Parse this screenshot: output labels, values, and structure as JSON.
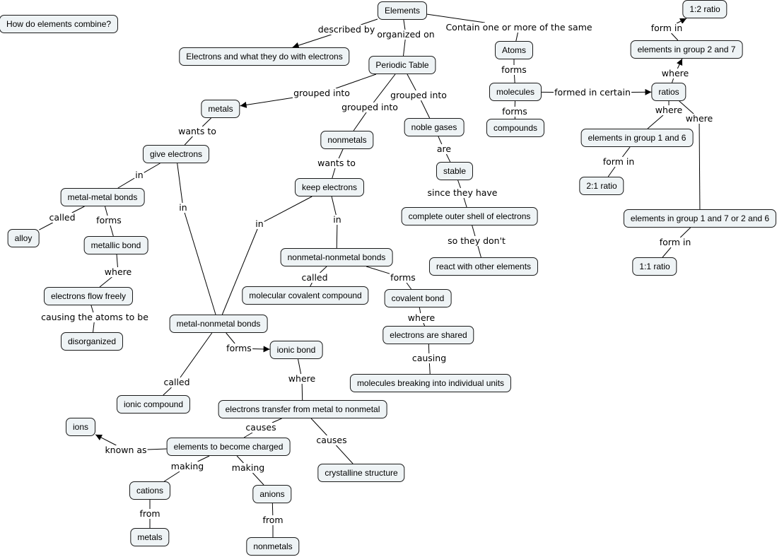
{
  "diagram_type": "concept map",
  "colors": {
    "node_fill": "#eef3f5",
    "node_border": "#1a1a1a",
    "line": "#000000"
  },
  "nodes": {
    "question": "How do elements combine?",
    "elements": "Elements",
    "electrons_desc": "Electrons and what they do with electrons",
    "periodic_table": "Periodic Table",
    "atoms": "Atoms",
    "molecules": "molecules",
    "compounds": "compounds",
    "ratios": "ratios",
    "ratio_12": "1:2 ratio",
    "group_2_7": "elements in group 2 and 7",
    "group_1_6": "elements in group 1 and 6",
    "ratio_21": "2:1 ratio",
    "group_17_26": "elements in group 1 and 7 or 2 and 6",
    "ratio_11": "1:1 ratio",
    "metals": "metals",
    "give_electrons": "give electrons",
    "metal_metal": "metal-metal bonds",
    "alloy": "alloy",
    "metallic_bond": "metallic bond",
    "flow_freely": "electrons flow freely",
    "disorganized": "disorganized",
    "nonmetals": "nonmetals",
    "keep_electrons": "keep electrons",
    "nonmetal_nonmetal": "nonmetal-nonmetal bonds",
    "molecular_covalent": "molecular covalent compound",
    "covalent_bond": "covalent bond",
    "shared": "electrons are shared",
    "breaking": "molecules breaking into individual units",
    "noble_gases": "noble gases",
    "stable": "stable",
    "outer_shell": "complete outer shell of electrons",
    "react": "react with other elements",
    "metal_nonmetal": "metal-nonmetal bonds",
    "ionic_bond": "ionic bond",
    "ionic_compound": "ionic compound",
    "transfer": "electrons transfer from metal to nonmetal",
    "charged": "elements to become charged",
    "crystalline": "crystalline structure",
    "ions": "ions",
    "cations": "cations",
    "anions": "anions",
    "metals2": "metals",
    "nonmetals2": "nonmetals"
  },
  "links": [
    {
      "from": "elements",
      "to": "electrons_desc",
      "label": "described by",
      "arrow": true
    },
    {
      "from": "elements",
      "to": "periodic_table",
      "label": "organized on",
      "arrow": false
    },
    {
      "from": "elements",
      "to": "atoms",
      "label": "Contain one or more of the same",
      "arrow": false
    },
    {
      "from": "atoms",
      "to": "molecules",
      "label": "forms",
      "arrow": false
    },
    {
      "from": "molecules",
      "to": "compounds",
      "label": "forms",
      "arrow": false
    },
    {
      "from": "molecules",
      "to": "ratios",
      "label": "formed in certain",
      "arrow": true
    },
    {
      "from": "ratios",
      "to": "group_2_7",
      "label": "where",
      "arrow": true
    },
    {
      "from": "group_2_7",
      "to": "ratio_12",
      "label": "form in",
      "arrow": true
    },
    {
      "from": "ratios",
      "to": "group_1_6",
      "label": "where",
      "arrow": false
    },
    {
      "from": "group_1_6",
      "to": "ratio_21",
      "label": "form in",
      "arrow": false
    },
    {
      "from": "ratios",
      "to": "group_17_26",
      "label": "where",
      "arrow": false
    },
    {
      "from": "group_17_26",
      "to": "ratio_11",
      "label": "form in",
      "arrow": false
    },
    {
      "from": "periodic_table",
      "to": "metals",
      "label": "grouped into",
      "arrow": true
    },
    {
      "from": "periodic_table",
      "to": "nonmetals",
      "label": "grouped into",
      "arrow": false
    },
    {
      "from": "periodic_table",
      "to": "noble_gases",
      "label": "grouped into",
      "arrow": false
    },
    {
      "from": "metals",
      "to": "give_electrons",
      "label": "wants to",
      "arrow": false
    },
    {
      "from": "give_electrons",
      "to": "metal_metal",
      "label": "in",
      "arrow": false
    },
    {
      "from": "give_electrons",
      "to": "metal_nonmetal",
      "label": "in",
      "arrow": false
    },
    {
      "from": "metal_metal",
      "to": "alloy",
      "label": "called",
      "arrow": false
    },
    {
      "from": "metal_metal",
      "to": "metallic_bond",
      "label": "forms",
      "arrow": false
    },
    {
      "from": "metallic_bond",
      "to": "flow_freely",
      "label": "where",
      "arrow": false
    },
    {
      "from": "flow_freely",
      "to": "disorganized",
      "label": "causing the atoms to be",
      "arrow": false
    },
    {
      "from": "nonmetals",
      "to": "keep_electrons",
      "label": "wants to",
      "arrow": false
    },
    {
      "from": "keep_electrons",
      "to": "metal_nonmetal",
      "label": "in",
      "arrow": false
    },
    {
      "from": "keep_electrons",
      "to": "nonmetal_nonmetal",
      "label": "in",
      "arrow": false
    },
    {
      "from": "nonmetal_nonmetal",
      "to": "molecular_covalent",
      "label": "called",
      "arrow": false
    },
    {
      "from": "nonmetal_nonmetal",
      "to": "covalent_bond",
      "label": "forms",
      "arrow": false
    },
    {
      "from": "covalent_bond",
      "to": "shared",
      "label": "where",
      "arrow": false
    },
    {
      "from": "shared",
      "to": "breaking",
      "label": "causing",
      "arrow": false
    },
    {
      "from": "noble_gases",
      "to": "stable",
      "label": "are",
      "arrow": false
    },
    {
      "from": "stable",
      "to": "outer_shell",
      "label": "since they have",
      "arrow": false
    },
    {
      "from": "outer_shell",
      "to": "react",
      "label": "so they don't",
      "arrow": false
    },
    {
      "from": "metal_nonmetal",
      "to": "ionic_bond",
      "label": "forms",
      "arrow": true
    },
    {
      "from": "metal_nonmetal",
      "to": "ionic_compound",
      "label": "called",
      "arrow": false
    },
    {
      "from": "ionic_bond",
      "to": "transfer",
      "label": "where",
      "arrow": false
    },
    {
      "from": "transfer",
      "to": "charged",
      "label": "causes",
      "arrow": false
    },
    {
      "from": "transfer",
      "to": "crystalline",
      "label": "causes",
      "arrow": false
    },
    {
      "from": "charged",
      "to": "ions",
      "label": "known as",
      "arrow": true
    },
    {
      "from": "charged",
      "to": "cations",
      "label": "making",
      "arrow": false
    },
    {
      "from": "charged",
      "to": "anions",
      "label": "making",
      "arrow": false
    },
    {
      "from": "cations",
      "to": "metals2",
      "label": "from",
      "arrow": false
    },
    {
      "from": "anions",
      "to": "nonmetals2",
      "label": "from",
      "arrow": false
    }
  ]
}
